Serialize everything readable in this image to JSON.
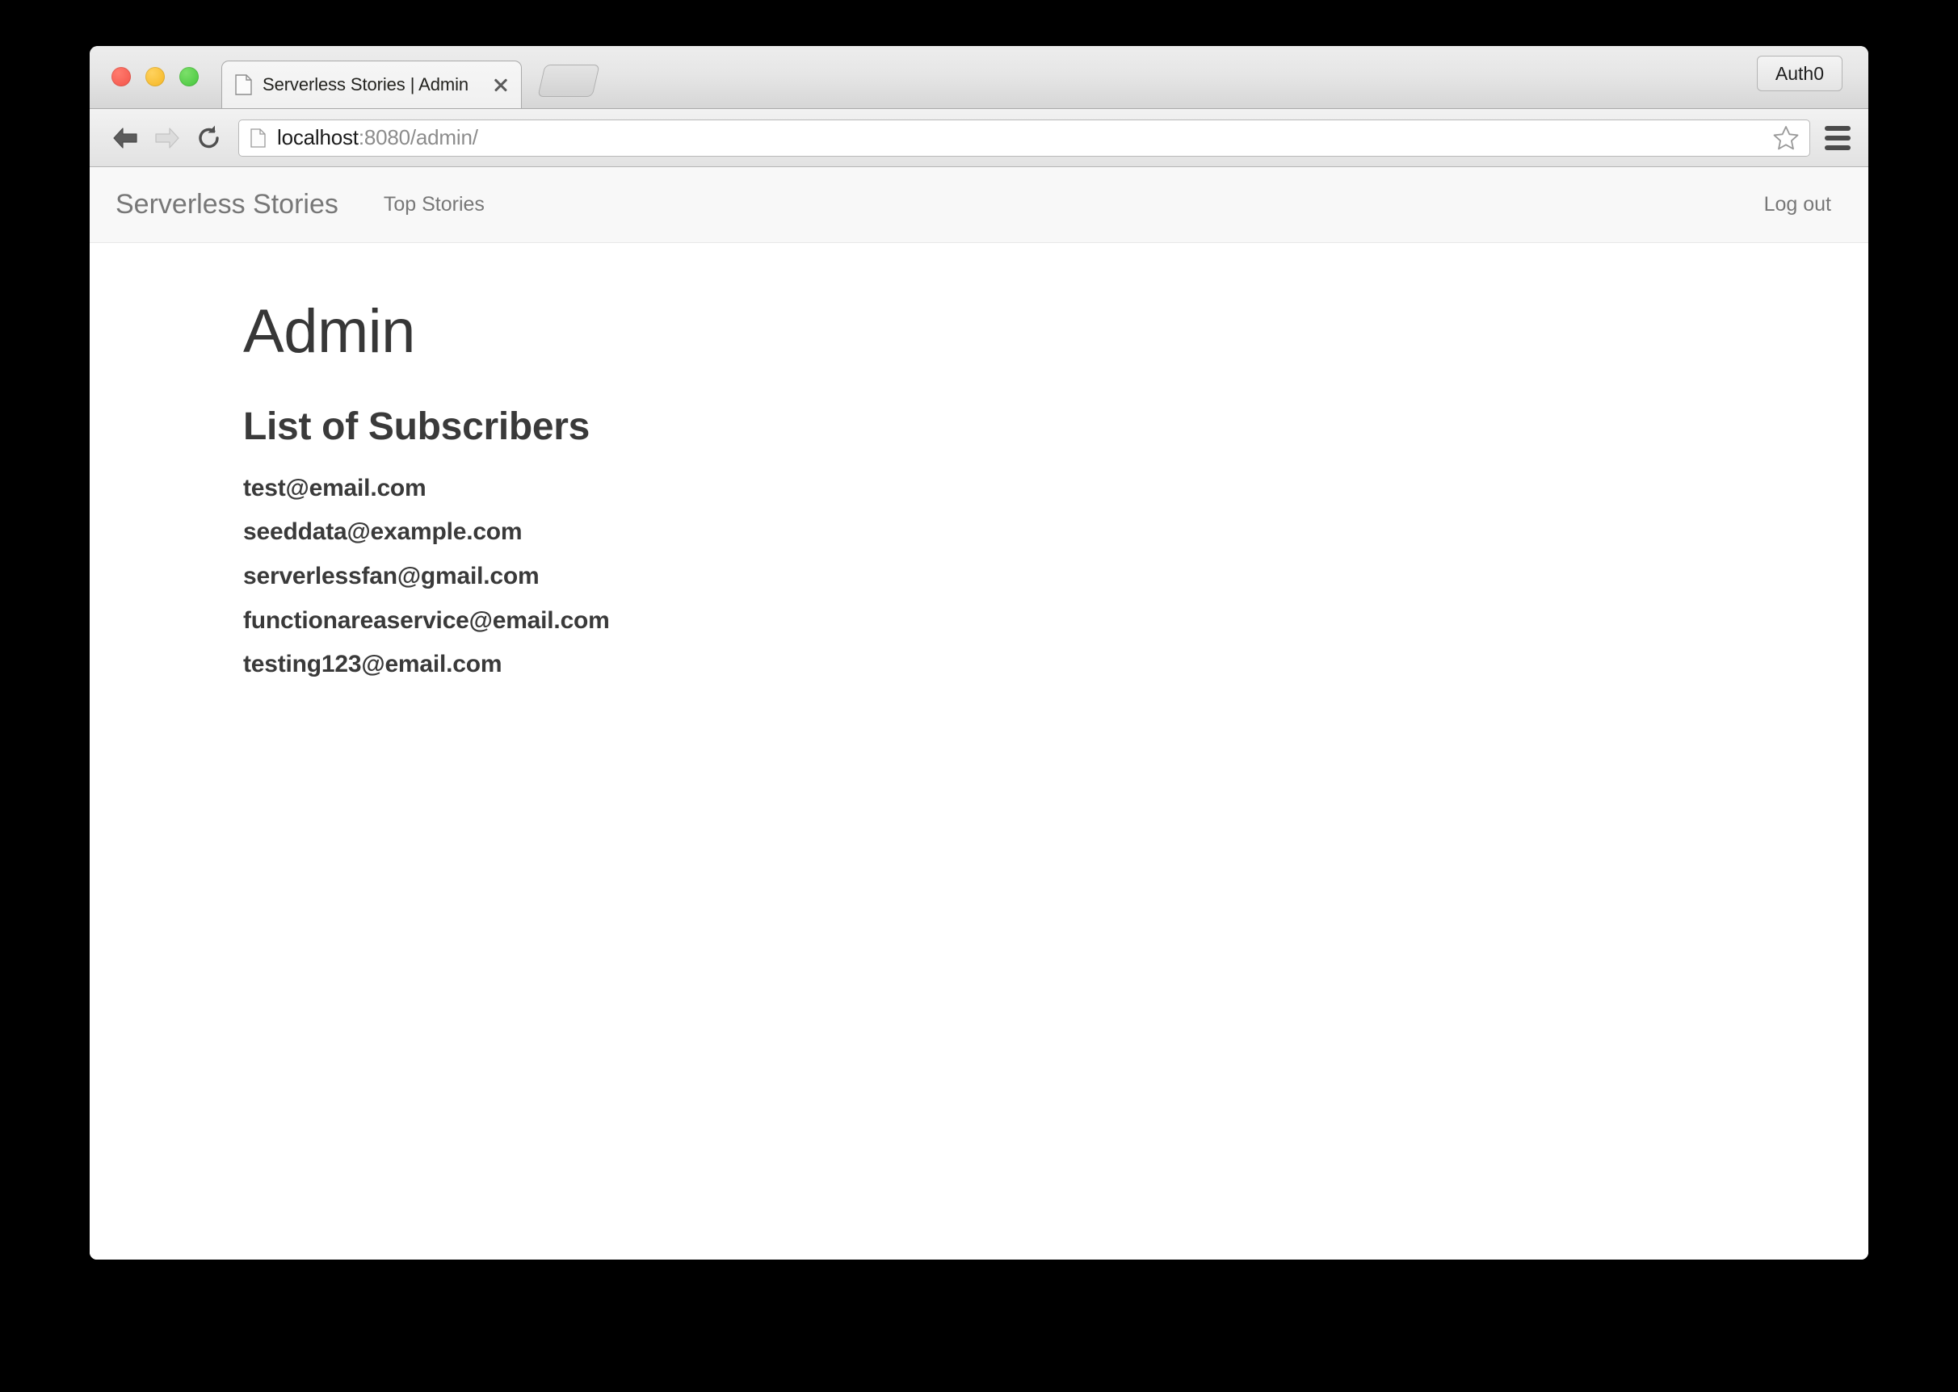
{
  "browser": {
    "tab": {
      "title": "Serverless Stories | Admin",
      "favicon_icon": "document-icon",
      "close_icon": "close-icon"
    },
    "new_tab_icon": "new-tab-button",
    "traffic_lights": {
      "close": "close-window-button",
      "minimize": "minimize-window-button",
      "maximize": "maximize-window-button",
      "red": "#f35349",
      "yellow": "#f4b521",
      "green": "#43c43a"
    },
    "extension": {
      "label": "Auth0",
      "name": "auth0-extension-button"
    },
    "toolbar": {
      "back_icon": "back-arrow-icon",
      "forward_icon": "forward-arrow-icon",
      "reload_icon": "reload-icon",
      "star_icon": "bookmark-star-icon",
      "menu_icon": "hamburger-menu-icon",
      "url_host": "localhost",
      "url_rest": ":8080/admin/",
      "url_full": "localhost:8080/admin/",
      "page_icon": "document-icon"
    }
  },
  "navbar": {
    "brand": "Serverless Stories",
    "links": [
      {
        "label": "Top Stories",
        "name": "nav-link-top-stories"
      }
    ],
    "logout_label": "Log out"
  },
  "main": {
    "page_title": "Admin",
    "section_title": "List of Subscribers",
    "subscribers": [
      "test@email.com",
      "seeddata@example.com",
      "serverlessfan@gmail.com",
      "functionareaservice@email.com",
      "testing123@email.com"
    ]
  },
  "colors": {
    "page_background": "#ffffff",
    "navbar_background": "#f8f8f8",
    "desktop_background": "#000000",
    "text_dark": "#3a3a3a",
    "text_muted": "#777777"
  }
}
